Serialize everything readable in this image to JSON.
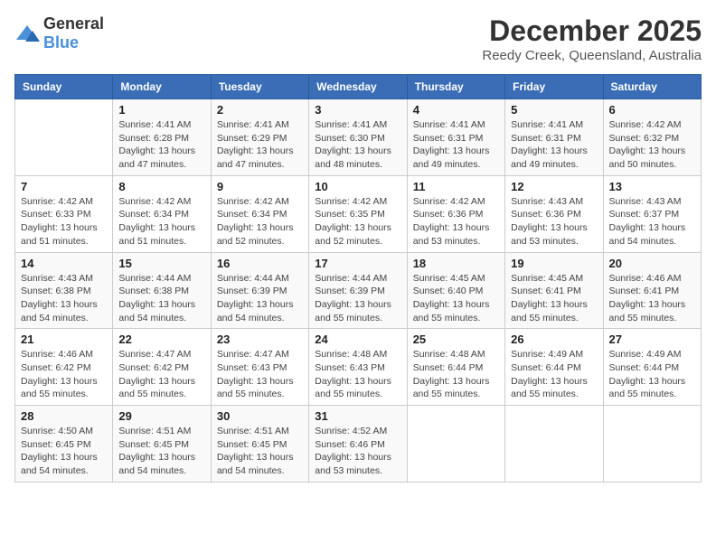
{
  "logo": {
    "general": "General",
    "blue": "Blue"
  },
  "title": "December 2025",
  "subtitle": "Reedy Creek, Queensland, Australia",
  "days_of_week": [
    "Sunday",
    "Monday",
    "Tuesday",
    "Wednesday",
    "Thursday",
    "Friday",
    "Saturday"
  ],
  "weeks": [
    [
      {
        "day": "",
        "info": ""
      },
      {
        "day": "1",
        "info": "Sunrise: 4:41 AM\nSunset: 6:28 PM\nDaylight: 13 hours\nand 47 minutes."
      },
      {
        "day": "2",
        "info": "Sunrise: 4:41 AM\nSunset: 6:29 PM\nDaylight: 13 hours\nand 47 minutes."
      },
      {
        "day": "3",
        "info": "Sunrise: 4:41 AM\nSunset: 6:30 PM\nDaylight: 13 hours\nand 48 minutes."
      },
      {
        "day": "4",
        "info": "Sunrise: 4:41 AM\nSunset: 6:31 PM\nDaylight: 13 hours\nand 49 minutes."
      },
      {
        "day": "5",
        "info": "Sunrise: 4:41 AM\nSunset: 6:31 PM\nDaylight: 13 hours\nand 49 minutes."
      },
      {
        "day": "6",
        "info": "Sunrise: 4:42 AM\nSunset: 6:32 PM\nDaylight: 13 hours\nand 50 minutes."
      }
    ],
    [
      {
        "day": "7",
        "info": "Sunrise: 4:42 AM\nSunset: 6:33 PM\nDaylight: 13 hours\nand 51 minutes."
      },
      {
        "day": "8",
        "info": "Sunrise: 4:42 AM\nSunset: 6:34 PM\nDaylight: 13 hours\nand 51 minutes."
      },
      {
        "day": "9",
        "info": "Sunrise: 4:42 AM\nSunset: 6:34 PM\nDaylight: 13 hours\nand 52 minutes."
      },
      {
        "day": "10",
        "info": "Sunrise: 4:42 AM\nSunset: 6:35 PM\nDaylight: 13 hours\nand 52 minutes."
      },
      {
        "day": "11",
        "info": "Sunrise: 4:42 AM\nSunset: 6:36 PM\nDaylight: 13 hours\nand 53 minutes."
      },
      {
        "day": "12",
        "info": "Sunrise: 4:43 AM\nSunset: 6:36 PM\nDaylight: 13 hours\nand 53 minutes."
      },
      {
        "day": "13",
        "info": "Sunrise: 4:43 AM\nSunset: 6:37 PM\nDaylight: 13 hours\nand 54 minutes."
      }
    ],
    [
      {
        "day": "14",
        "info": "Sunrise: 4:43 AM\nSunset: 6:38 PM\nDaylight: 13 hours\nand 54 minutes."
      },
      {
        "day": "15",
        "info": "Sunrise: 4:44 AM\nSunset: 6:38 PM\nDaylight: 13 hours\nand 54 minutes."
      },
      {
        "day": "16",
        "info": "Sunrise: 4:44 AM\nSunset: 6:39 PM\nDaylight: 13 hours\nand 54 minutes."
      },
      {
        "day": "17",
        "info": "Sunrise: 4:44 AM\nSunset: 6:39 PM\nDaylight: 13 hours\nand 55 minutes."
      },
      {
        "day": "18",
        "info": "Sunrise: 4:45 AM\nSunset: 6:40 PM\nDaylight: 13 hours\nand 55 minutes."
      },
      {
        "day": "19",
        "info": "Sunrise: 4:45 AM\nSunset: 6:41 PM\nDaylight: 13 hours\nand 55 minutes."
      },
      {
        "day": "20",
        "info": "Sunrise: 4:46 AM\nSunset: 6:41 PM\nDaylight: 13 hours\nand 55 minutes."
      }
    ],
    [
      {
        "day": "21",
        "info": "Sunrise: 4:46 AM\nSunset: 6:42 PM\nDaylight: 13 hours\nand 55 minutes."
      },
      {
        "day": "22",
        "info": "Sunrise: 4:47 AM\nSunset: 6:42 PM\nDaylight: 13 hours\nand 55 minutes."
      },
      {
        "day": "23",
        "info": "Sunrise: 4:47 AM\nSunset: 6:43 PM\nDaylight: 13 hours\nand 55 minutes."
      },
      {
        "day": "24",
        "info": "Sunrise: 4:48 AM\nSunset: 6:43 PM\nDaylight: 13 hours\nand 55 minutes."
      },
      {
        "day": "25",
        "info": "Sunrise: 4:48 AM\nSunset: 6:44 PM\nDaylight: 13 hours\nand 55 minutes."
      },
      {
        "day": "26",
        "info": "Sunrise: 4:49 AM\nSunset: 6:44 PM\nDaylight: 13 hours\nand 55 minutes."
      },
      {
        "day": "27",
        "info": "Sunrise: 4:49 AM\nSunset: 6:44 PM\nDaylight: 13 hours\nand 55 minutes."
      }
    ],
    [
      {
        "day": "28",
        "info": "Sunrise: 4:50 AM\nSunset: 6:45 PM\nDaylight: 13 hours\nand 54 minutes."
      },
      {
        "day": "29",
        "info": "Sunrise: 4:51 AM\nSunset: 6:45 PM\nDaylight: 13 hours\nand 54 minutes."
      },
      {
        "day": "30",
        "info": "Sunrise: 4:51 AM\nSunset: 6:45 PM\nDaylight: 13 hours\nand 54 minutes."
      },
      {
        "day": "31",
        "info": "Sunrise: 4:52 AM\nSunset: 6:46 PM\nDaylight: 13 hours\nand 53 minutes."
      },
      {
        "day": "",
        "info": ""
      },
      {
        "day": "",
        "info": ""
      },
      {
        "day": "",
        "info": ""
      }
    ]
  ]
}
